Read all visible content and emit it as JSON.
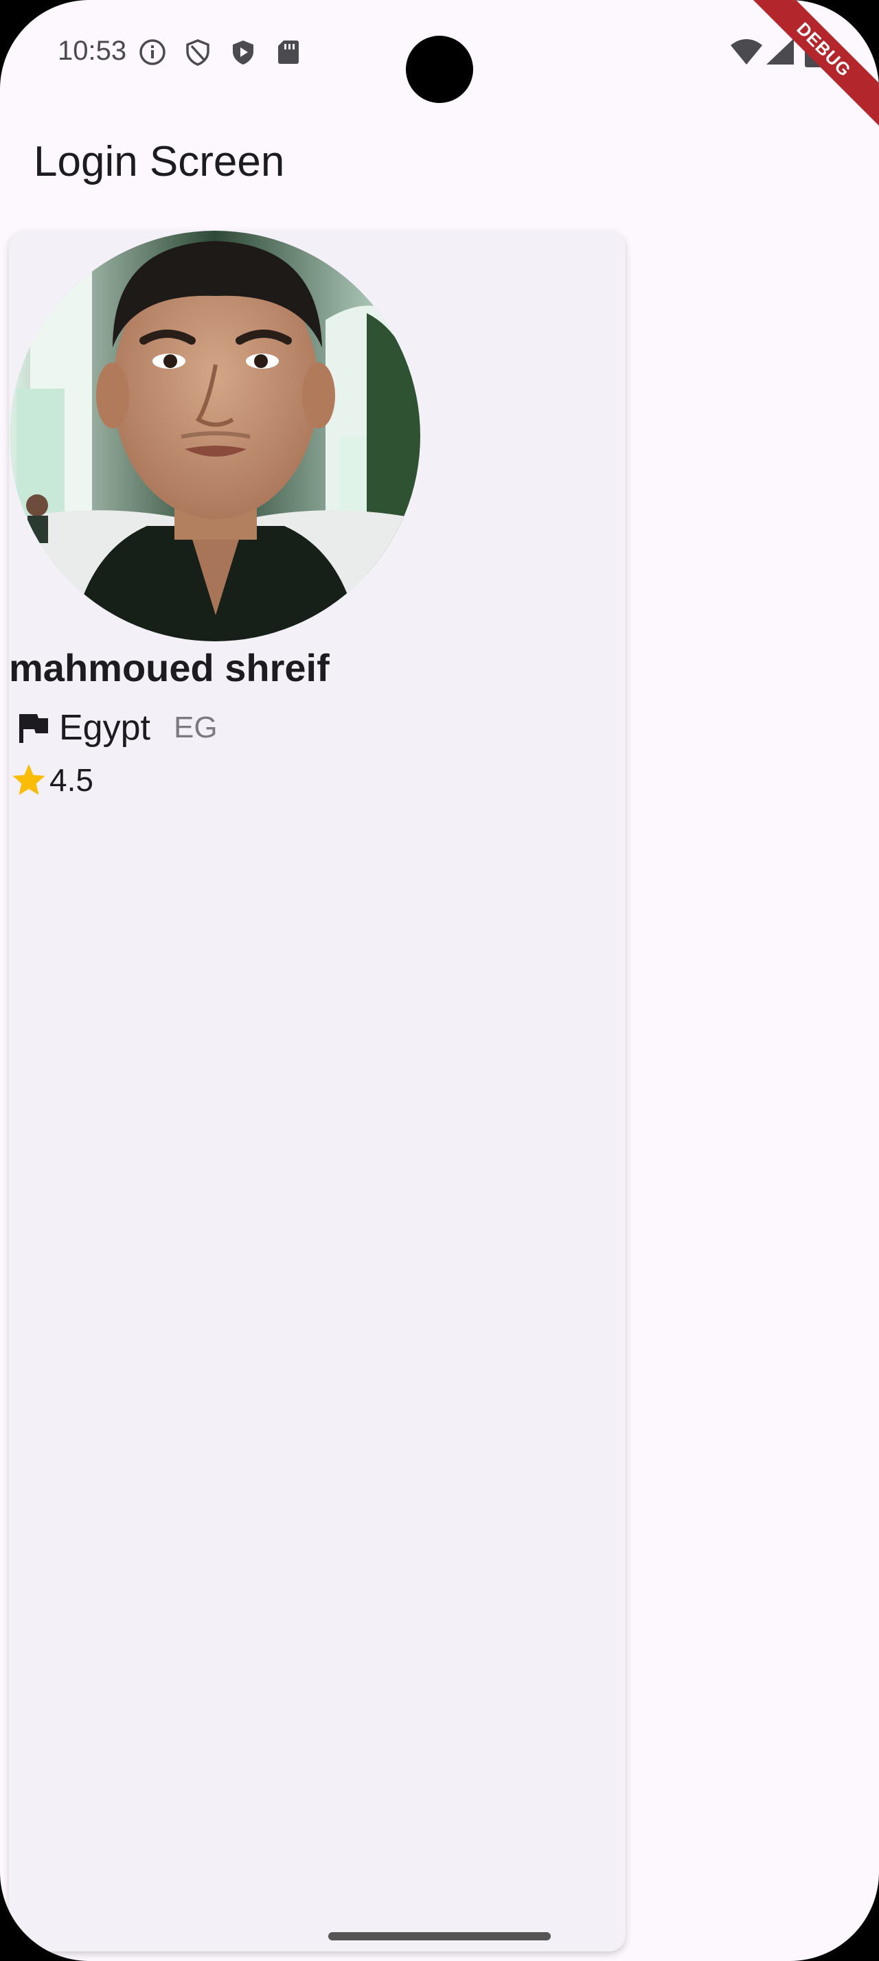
{
  "status_bar": {
    "time": "10:53",
    "left_icons": [
      "info-icon",
      "shield-outline-icon",
      "play-protect-icon",
      "sd-card-icon"
    ],
    "right_icons": [
      "wifi-icon",
      "cellular-signal-icon",
      "battery-icon"
    ],
    "debug_banner": "DEBUG"
  },
  "app_bar": {
    "title": "Login Screen"
  },
  "profile": {
    "name": "mahmoued shreif",
    "country_name": "Egypt",
    "country_code": "EG",
    "country_icon": "flag-icon",
    "rating": "4.5",
    "rating_icon": "star-icon"
  },
  "colors": {
    "background": "#fdf7fe",
    "card": "#f4f0f7",
    "star": "#fbbc05",
    "debug_banner": "#b3262c"
  }
}
